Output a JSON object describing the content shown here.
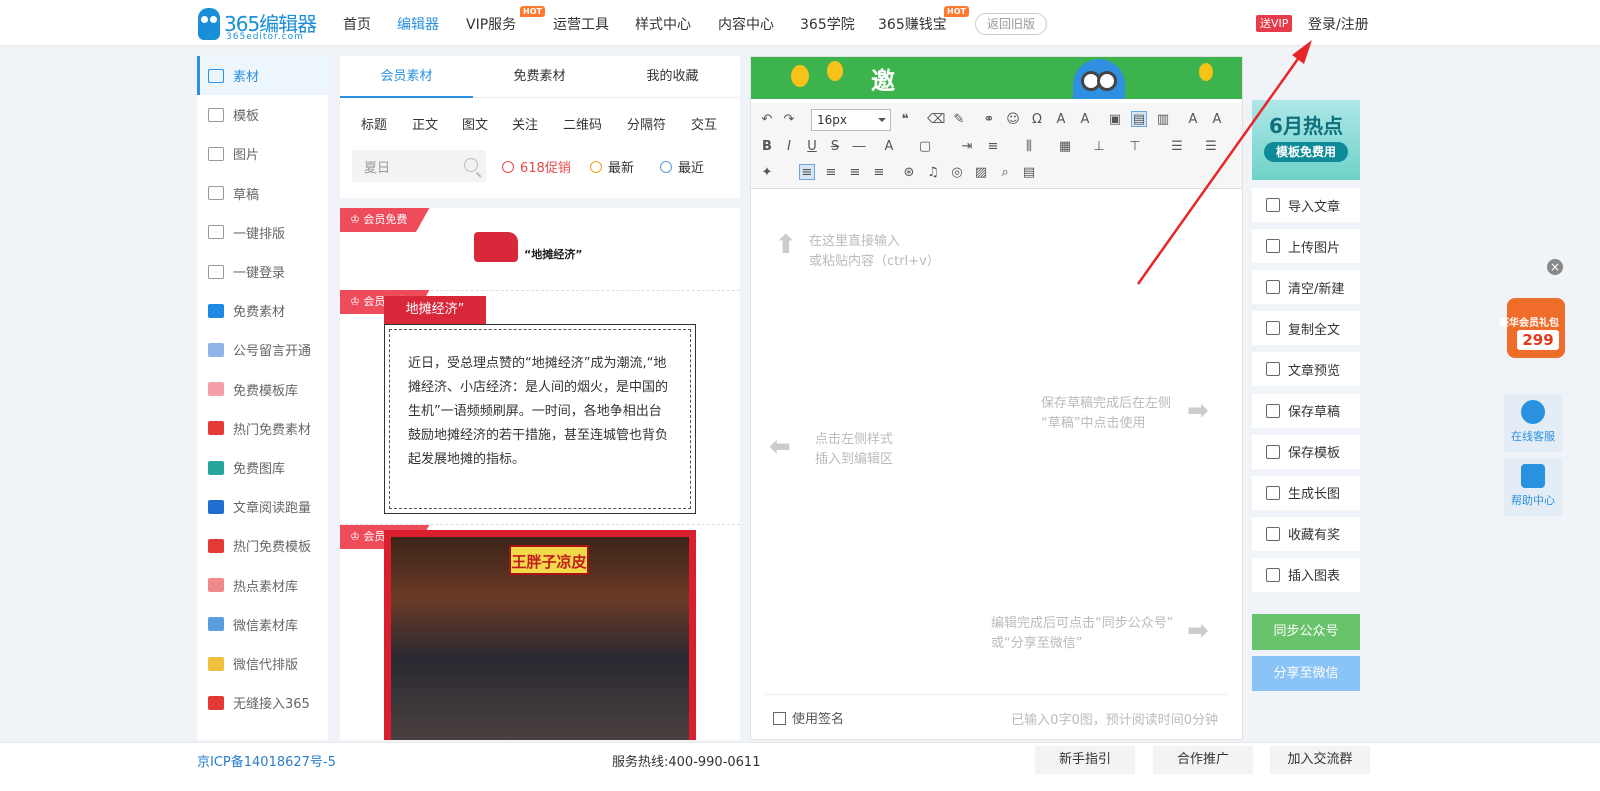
{
  "header": {
    "logo_main": "365编辑器",
    "logo_sub": "365editor.com",
    "nav": [
      "首页",
      "编辑器",
      "VIP服务",
      "运营工具",
      "样式中心",
      "内容中心",
      "365学院",
      "365赚钱宝"
    ],
    "hot_label": "HOT",
    "old_version": "返回旧版",
    "vip_badge": "送VIP",
    "login": "登录/注册"
  },
  "sidebar": {
    "items": [
      {
        "label": "素材",
        "icon": "folder-icon"
      },
      {
        "label": "模板",
        "icon": "template-icon"
      },
      {
        "label": "图片",
        "icon": "image-icon"
      },
      {
        "label": "草稿",
        "icon": "draft-icon"
      },
      {
        "label": "一键排版",
        "icon": "list-icon"
      },
      {
        "label": "一键登录",
        "icon": "login-icon"
      },
      {
        "label": "免费素材",
        "icon": "free-material-icon",
        "color": "#1e88e5"
      },
      {
        "label": "公号留言开通",
        "icon": "layers-icon",
        "color": "#8fb4e8"
      },
      {
        "label": "免费模板库",
        "icon": "folder-pink-icon",
        "color": "#f5a0a8"
      },
      {
        "label": "热门免费素材",
        "icon": "hot-material-icon",
        "color": "#e53935"
      },
      {
        "label": "免费图库",
        "icon": "gallery-icon",
        "color": "#26a69a"
      },
      {
        "label": "文章阅读跑量",
        "icon": "books-icon",
        "color": "#1e6fd0"
      },
      {
        "label": "热门免费模板",
        "icon": "hot-template-icon",
        "color": "#e53935"
      },
      {
        "label": "热点素材库",
        "icon": "hot-image-icon",
        "color": "#f08a8a"
      },
      {
        "label": "微信素材库",
        "icon": "wechat-material-icon",
        "color": "#5aa0e0"
      },
      {
        "label": "微信代排版",
        "icon": "wechat-layout-icon",
        "color": "#f0c040"
      },
      {
        "label": "无缝接入365",
        "icon": "connect-icon",
        "color": "#e53935"
      }
    ]
  },
  "materials": {
    "tabs": [
      "会员素材",
      "免费素材",
      "我的收藏"
    ],
    "categories": [
      "标题",
      "正文",
      "图文",
      "关注",
      "二维码",
      "分隔符",
      "交互"
    ],
    "search_value": "夏日",
    "filters": [
      "618促销",
      "最新",
      "最近"
    ],
    "card_tag": "会员免费",
    "card1_text": "“地摊经济”",
    "card2_title": "地摊经济”",
    "card2_body": "近日，受总理点赞的“地摊经济”成为潮流,“地摊经济、小店经济：是人间的烟火，是中国的生机”一语频频刷屏。一时间，各地争相出台鼓励地摊经济的若干措施，甚至连城管也背负起发展地摊的指标。",
    "card3_sign": "王胖子凉皮"
  },
  "editor": {
    "banner_text": "邀",
    "font_size": "16px",
    "hint_paste_1": "在这里直接输入",
    "hint_paste_2": "或粘贴内容（ctrl+v）",
    "hint_insert_1": "点击左侧样式",
    "hint_insert_2": "插入到编辑区",
    "hint_draft_1": "保存草稿完成后在左侧",
    "hint_draft_2": "“草稿”中点击使用",
    "hint_sync_1": "编辑完成后可点击“同步公众号”",
    "hint_sync_2": "或“分享至微信”",
    "signature": "使用签名",
    "word_count": "已输入0字0图，预计阅读时间0分钟"
  },
  "actions": {
    "promo_title": "6月热点",
    "promo_sub": "模板免费用",
    "items": [
      "导入文章",
      "上传图片",
      "清空/新建",
      "复制全文",
      "文章预览",
      "保存草稿",
      "保存模板",
      "生成长图",
      "收藏有奖",
      "插入图表"
    ],
    "sync": "同步公众号",
    "share": "分享至微信"
  },
  "float": {
    "gift_text": "豪华会员礼包",
    "gift_price": "299",
    "service": "在线客服",
    "help": "帮助中心"
  },
  "footer": {
    "icp": "京ICP备14018627号-5",
    "hotline": "服务热线:400-990-0611",
    "buttons": [
      "新手指引",
      "合作推广",
      "加入交流群"
    ]
  },
  "colors": {
    "accent": "#2a91e0",
    "tag_red": "#ee4c5a",
    "sync_green": "#69c36a",
    "share_blue": "#8ac3f5"
  }
}
